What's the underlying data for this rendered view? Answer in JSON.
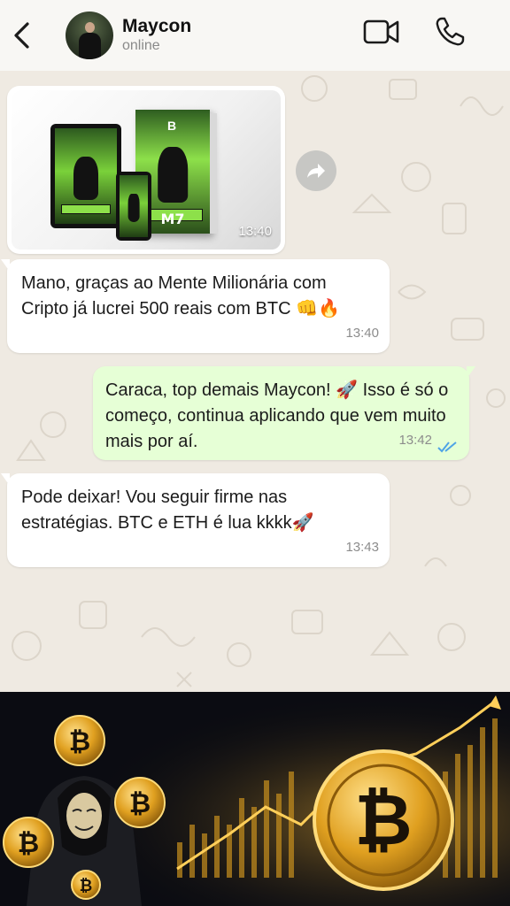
{
  "header": {
    "contact_name": "Maycon",
    "status": "online",
    "icons": [
      "back-arrow-icon",
      "video-call-icon",
      "phone-call-icon"
    ]
  },
  "messages": [
    {
      "type": "image",
      "direction": "incoming",
      "time": "13:40"
    },
    {
      "type": "text",
      "direction": "incoming",
      "text": "Mano, graças ao Mente Milionária com Cripto já lucrei 500 reais com BTC 👊🔥",
      "time": "13:40"
    },
    {
      "type": "text",
      "direction": "outgoing",
      "text": "Caraca, top demais Maycon! 🚀 Isso é só o começo, continua aplicando que vem muito mais por aí.",
      "time": "13:42",
      "status": "read"
    },
    {
      "type": "text",
      "direction": "incoming",
      "text": "Pode deixar! Vou seguir firme nas estratégias. BTC e ETH é lua kkkk🚀",
      "time": "13:43"
    }
  ],
  "media": {
    "badge_letter": "B",
    "logo_text": "M7"
  },
  "colors": {
    "chat_background": "#efeae2",
    "outgoing_bubble": "#e6ffd6",
    "incoming_bubble": "#ffffff",
    "read_ticks": "#4fa3e6",
    "banner_gold": "#f2b233"
  }
}
